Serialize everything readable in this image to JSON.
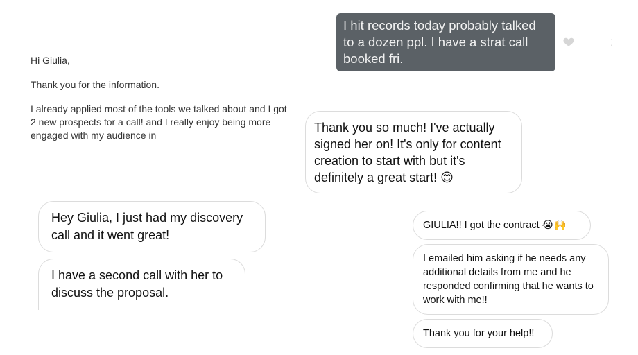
{
  "email": {
    "greeting": "Hi Giulia,",
    "line1": "Thank you for the information.",
    "line2": "I already applied most of the tools we talked about and I got 2 new prospects for a call!  and I really enjoy being more engaged with my audience in"
  },
  "dark_message": {
    "part1": "I hit records ",
    "underlined1": "today",
    "part2": " probably talked to a dozen ppl. I have a strat call booked ",
    "underlined2": "fri."
  },
  "messages": {
    "signed_her_on": "Thank you so much! I've actually signed her on! It's only for content creation to start with but it's definitely a great start!",
    "signed_emoji": "😊",
    "discovery_call": "Hey Giulia, I just had my discovery call and it went great!",
    "second_call": "I have a second call with her to discuss the proposal.",
    "contract": "GIULIA!! I got the contract",
    "contract_emoji": "😭🙌",
    "emailed_him": "I emailed him asking if he needs any additional details from me and he responded confirming that he wants to work with me!!",
    "thanks": "Thank you for your help!!"
  },
  "icons": {
    "heart": "heart-icon",
    "more": "more-options-icon"
  },
  "colors": {
    "dark_bubble": "#5b6166",
    "bubble_border": "#dcdcdc"
  }
}
